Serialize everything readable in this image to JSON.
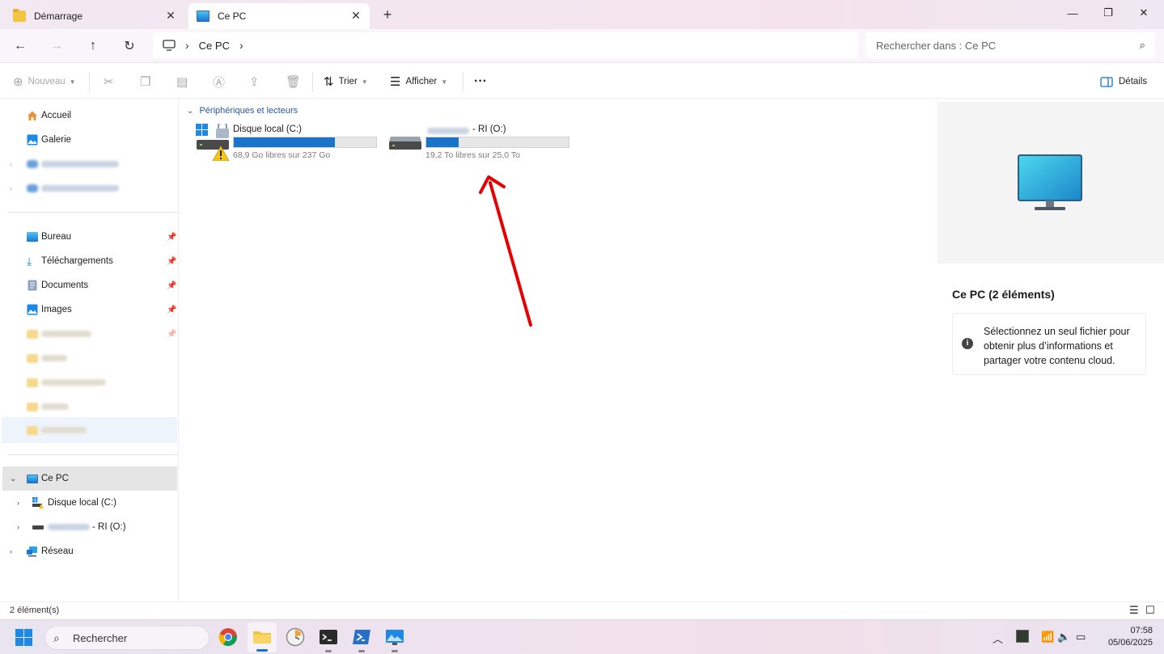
{
  "tabs": [
    {
      "label": "Démarrage",
      "icon": "folder-icon",
      "active": false
    },
    {
      "label": "Ce PC",
      "icon": "monitor-icon",
      "active": true
    }
  ],
  "window_buttons": {
    "minimize": "—",
    "maximize": "❐",
    "close": "✕"
  },
  "address": {
    "location": "Ce PC"
  },
  "search": {
    "placeholder": "Rechercher dans : Ce PC"
  },
  "toolbar": {
    "new_label": "Nouveau",
    "sort_label": "Trier",
    "view_label": "Afficher",
    "more_label": "···",
    "details_label": "Détails"
  },
  "sidebar": {
    "quick": [
      {
        "label": "Accueil",
        "icon": "home-icon"
      },
      {
        "label": "Galerie",
        "icon": "gallery-icon"
      }
    ],
    "pinned": [
      {
        "label": "Bureau",
        "icon": "desktop-icon"
      },
      {
        "label": "Téléchargements",
        "icon": "download-icon"
      },
      {
        "label": "Documents",
        "icon": "documents-icon"
      },
      {
        "label": "Images",
        "icon": "images-icon"
      }
    ],
    "this_pc": {
      "label": "Ce PC",
      "icon": "monitor-icon"
    },
    "drives": [
      {
        "label": "Disque local (C:)",
        "icon": "windows-drive-icon"
      },
      {
        "label": "- RI (O:)",
        "icon": "network-drive-icon"
      }
    ],
    "network": {
      "label": "Réseau",
      "icon": "network-icon"
    }
  },
  "main": {
    "group_header": "Périphériques et lecteurs",
    "drives": [
      {
        "name": "Disque local (C:)",
        "free_text": "68,9 Go libres sur 237 Go",
        "used_fraction": 0.71
      },
      {
        "name": "- RI (O:)",
        "free_text": "19,2 To libres sur 25,0 To",
        "used_fraction": 0.23
      }
    ]
  },
  "details": {
    "title": "Ce PC (2 éléments)",
    "info_text": "Sélectionnez un seul fichier pour obtenir plus d’informations et partager votre contenu cloud."
  },
  "status": {
    "item_count": "2 élément(s)"
  },
  "taskbar": {
    "search_label": "Rechercher",
    "time": "07:58",
    "date": "05/06/2025"
  },
  "colors": {
    "accent": "#1a73c9",
    "annotation_arrow": "#e60000"
  }
}
